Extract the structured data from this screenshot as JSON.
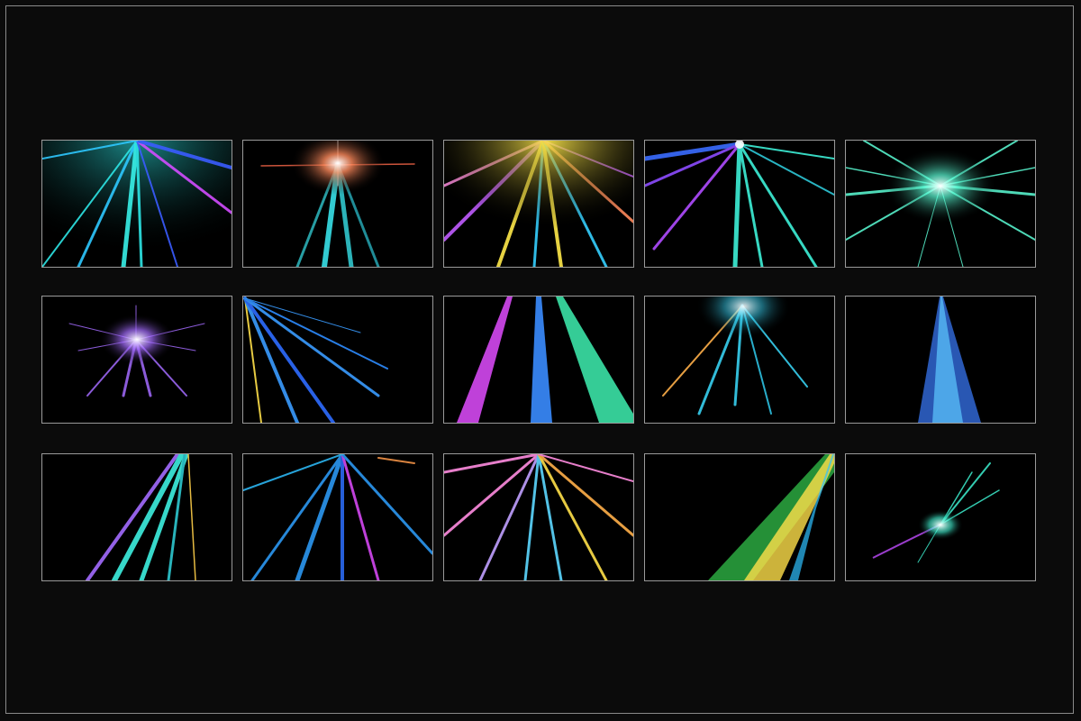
{
  "gallery": {
    "rows": 3,
    "columns": 5,
    "background_color": "#0b0b0b",
    "frame_color": "#8a8a8a",
    "thumb_border_color": "#9a9a9a",
    "thumbnails": [
      {
        "effect": "light-rays-top-center-cyan-blue-magenta",
        "colors": [
          "#2ee6e6",
          "#3a5cff",
          "#d24cff"
        ]
      },
      {
        "effect": "light-burst-top-center-orange-cyan",
        "colors": [
          "#ff8a5c",
          "#38e0e8"
        ]
      },
      {
        "effect": "light-rays-top-rainbow-yellow",
        "colors": [
          "#ffe94a",
          "#c05cff",
          "#36d0ff"
        ]
      },
      {
        "effect": "light-rays-top-center-teal-purple",
        "colors": [
          "#3ef0d8",
          "#8c4cff",
          "#3a6cff"
        ]
      },
      {
        "effect": "light-burst-center-teal",
        "colors": [
          "#5cffd8",
          "#2ec8b0"
        ]
      },
      {
        "effect": "star-burst-center-violet",
        "colors": [
          "#a46cff",
          "#6a4cff"
        ]
      },
      {
        "effect": "light-rays-top-left-blue-yellow",
        "colors": [
          "#3a9cff",
          "#ffe04a",
          "#2e6cff"
        ]
      },
      {
        "effect": "light-beams-three-magenta-blue-green",
        "colors": [
          "#e04cff",
          "#3a8cff",
          "#3ef0b0"
        ]
      },
      {
        "effect": "light-rays-top-center-orange-cyan",
        "colors": [
          "#ffb04a",
          "#38d0f0"
        ]
      },
      {
        "effect": "light-beam-narrow-blue",
        "colors": [
          "#3a7cff",
          "#5cc8ff"
        ]
      },
      {
        "effect": "light-streaks-diagonal-cyan-purple",
        "colors": [
          "#3ef0e0",
          "#a46cff",
          "#ffd04a"
        ]
      },
      {
        "effect": "light-rays-top-blue-magenta",
        "colors": [
          "#2ea0ff",
          "#e04cff",
          "#ff9a4a"
        ]
      },
      {
        "effect": "light-rays-top-pastel-rainbow",
        "colors": [
          "#ff8ce0",
          "#5cd8ff",
          "#ffe04a"
        ]
      },
      {
        "effect": "light-streak-diagonal-green-yellow",
        "colors": [
          "#3ef05c",
          "#ffe04a",
          "#2ec0ff"
        ]
      },
      {
        "effect": "lens-flare-curve-teal-purple",
        "colors": [
          "#3ef0d0",
          "#c04cff"
        ]
      }
    ]
  }
}
